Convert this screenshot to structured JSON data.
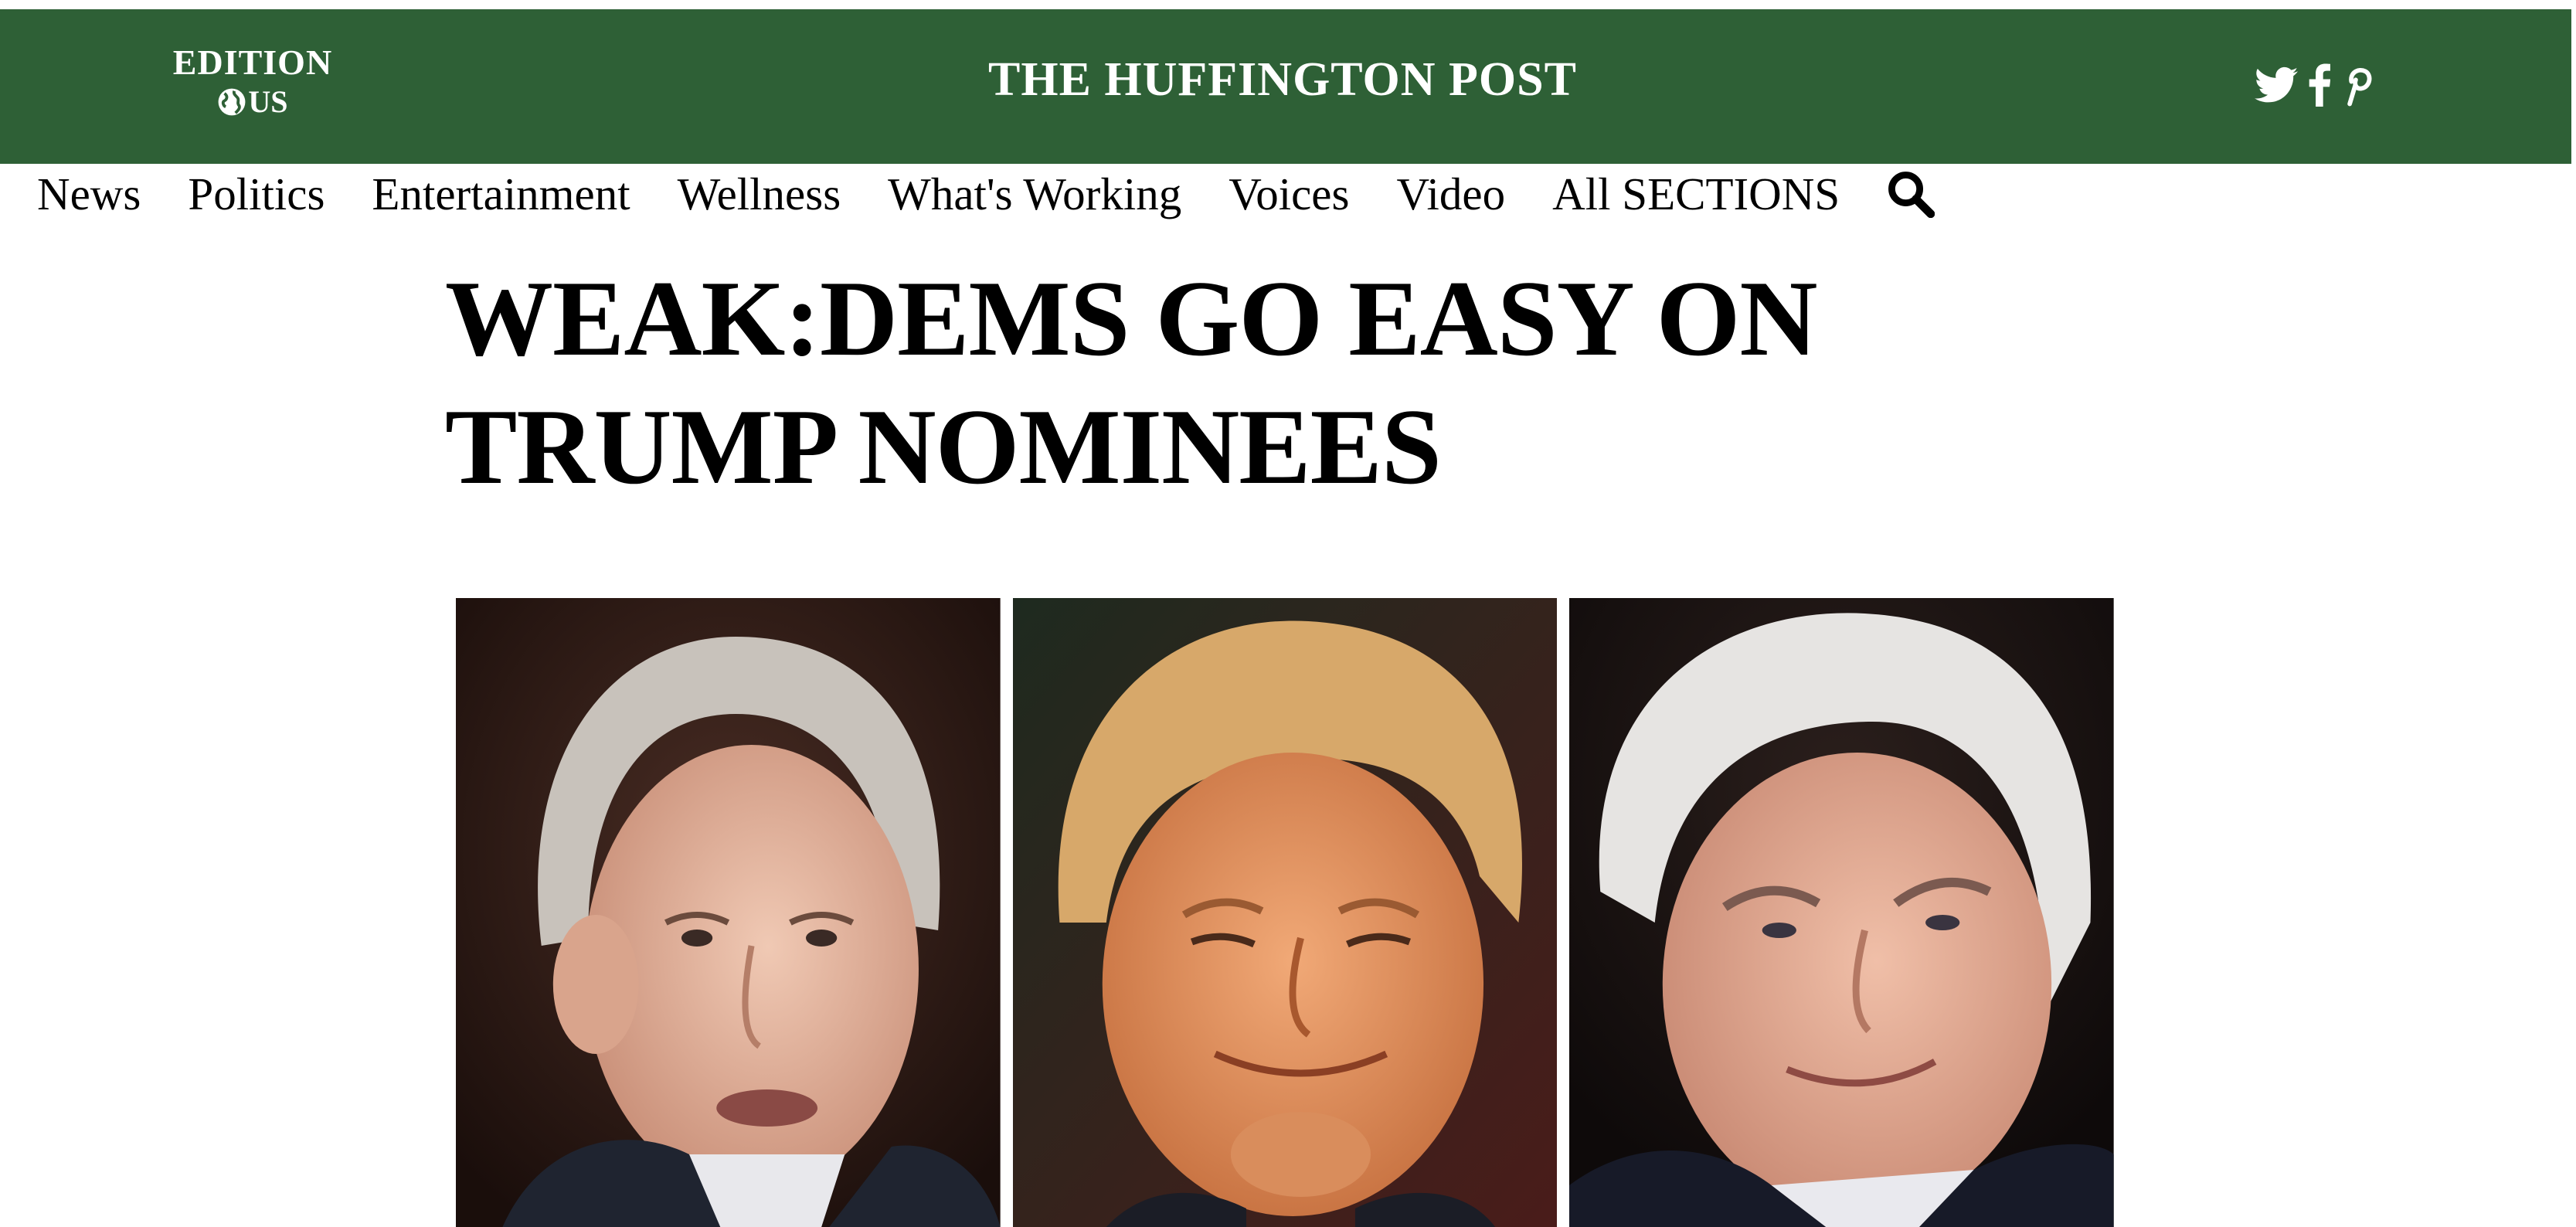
{
  "header": {
    "edition_label": "EDITION",
    "edition_region": "US",
    "site_title": "THE HUFFINGTON POST",
    "social_icons": [
      "twitter-icon",
      "facebook-icon",
      "pinterest-icon"
    ],
    "background_color": "#2e6036"
  },
  "nav": {
    "items": [
      "News",
      "Politics",
      "Entertainment",
      "Wellness",
      "What's Working",
      "Voices",
      "Video",
      "All SECTIONS"
    ],
    "search_icon": "search-icon"
  },
  "article": {
    "headline": "WEAK:DEMS GO EASY ON TRUMP NOMINEES",
    "photos": [
      "photo-portrait-left",
      "photo-portrait-center",
      "photo-portrait-right"
    ]
  }
}
